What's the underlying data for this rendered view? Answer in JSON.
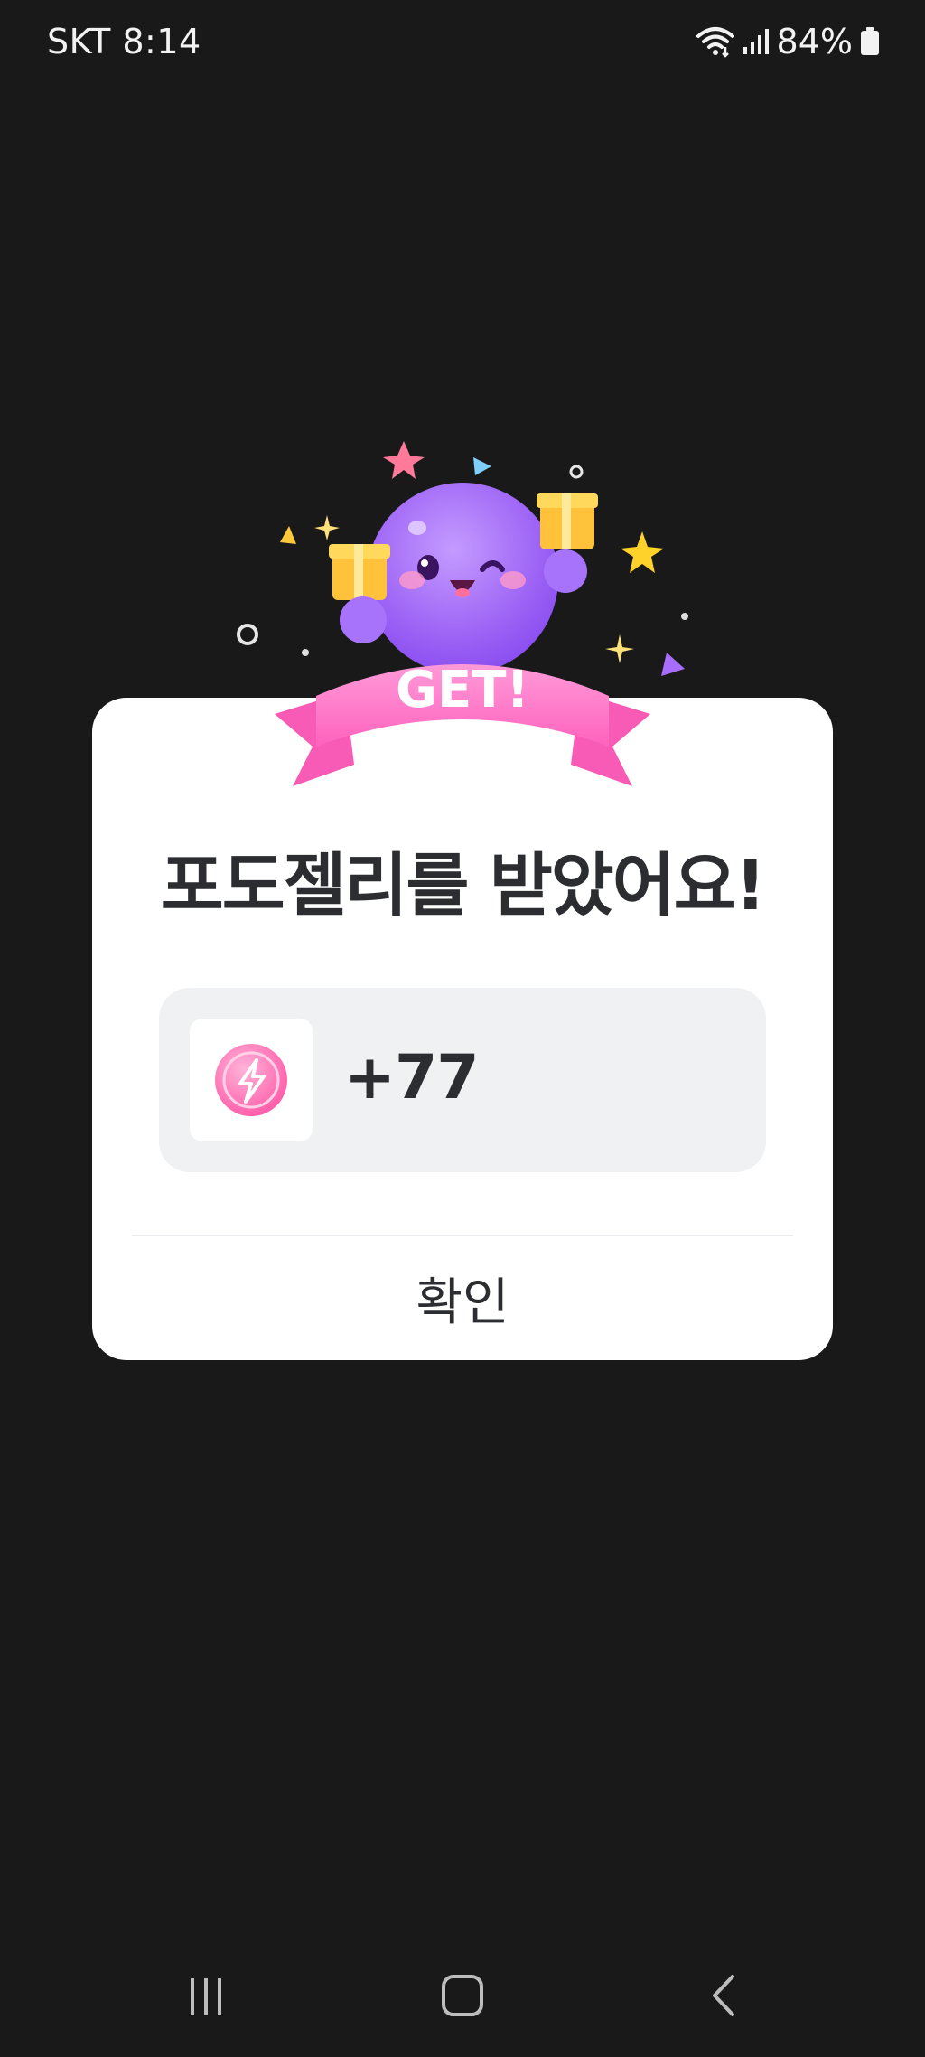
{
  "status_bar": {
    "carrier_time": "SKT 8:14",
    "battery": "84%",
    "icons": [
      "wifi-icon",
      "signal-icon",
      "battery-icon"
    ]
  },
  "dialog": {
    "badge_text": "GET!",
    "title": "포도젤리를 받았어요!",
    "reward": {
      "icon": "jelly-bolt-icon",
      "amount": "+77"
    },
    "confirm_label": "확인"
  },
  "nav_bar": {
    "buttons": [
      "recents-button",
      "home-button",
      "back-button"
    ]
  },
  "colors": {
    "background": "#19191a",
    "dialog": "#ffffff",
    "reward_box": "#f0f1f3",
    "ribbon_pink": "#ff79c6",
    "mascot_purple": "#a066ff",
    "jelly_pink": "#ff6fb1"
  }
}
